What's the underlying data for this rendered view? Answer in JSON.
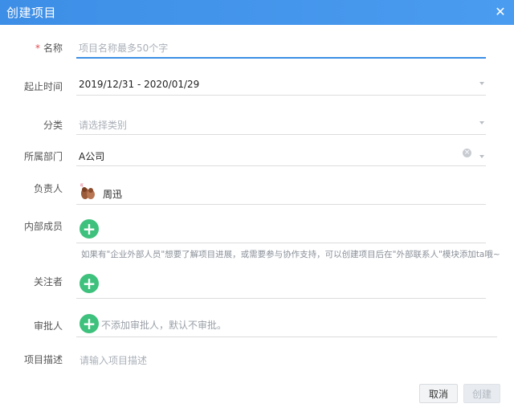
{
  "dialog": {
    "title": "创建项目",
    "close_glyph": "✕"
  },
  "form": {
    "name": {
      "required_mark": "*",
      "label": "名称",
      "placeholder": "项目名称最多50个字"
    },
    "date_range": {
      "label": "起止时间",
      "value": "2019/12/31 - 2020/01/29"
    },
    "category": {
      "label": "分类",
      "placeholder": "请选择类别"
    },
    "department": {
      "label": "所属部门",
      "value": "A公司"
    },
    "owner": {
      "label": "负责人",
      "name": "周迅"
    },
    "members": {
      "label": "内部成员",
      "hint": "如果有\"企业外部人员\"想要了解项目进展，或需要参与协作支持，可以创建项目后在\"外部联系人\"模块添加ta哦~"
    },
    "followers": {
      "label": "关注者"
    },
    "approver": {
      "label": "审批人",
      "note": "不添加审批人，默认不审批。"
    },
    "description": {
      "label": "项目描述",
      "placeholder": "请输入项目描述"
    }
  },
  "buttons": {
    "cancel": "取消",
    "create": "创建"
  },
  "colors": {
    "header": "#3d8ee6",
    "add_button": "#3ec17c",
    "required": "#e5484d"
  }
}
